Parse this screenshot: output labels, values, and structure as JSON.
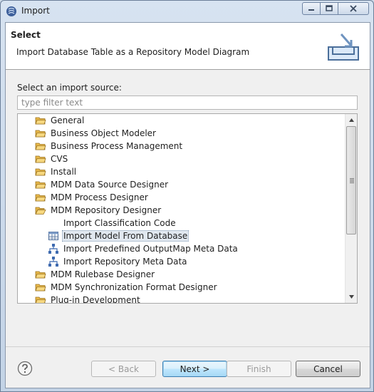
{
  "window": {
    "title": "Import"
  },
  "header": {
    "title": "Select",
    "description": "Import Database Table as a Repository Model Diagram"
  },
  "source": {
    "label": "Select an import source:",
    "filter_placeholder": "type filter text",
    "filter_value": ""
  },
  "tree": {
    "items": [
      {
        "label": "General",
        "type": "folder",
        "level": 0
      },
      {
        "label": "Business Object Modeler",
        "type": "folder",
        "level": 0
      },
      {
        "label": "Business Process Management",
        "type": "folder",
        "level": 0
      },
      {
        "label": "CVS",
        "type": "folder",
        "level": 0
      },
      {
        "label": "Install",
        "type": "folder",
        "level": 0
      },
      {
        "label": "MDM Data Source Designer",
        "type": "folder",
        "level": 0
      },
      {
        "label": "MDM Process Designer",
        "type": "folder",
        "level": 0
      },
      {
        "label": "MDM Repository Designer",
        "type": "folder-open",
        "level": 0
      },
      {
        "label": "Import Classification Code",
        "type": "none",
        "level": 1
      },
      {
        "label": "Import Model From Database",
        "type": "table",
        "level": 1,
        "selected": true
      },
      {
        "label": "Import Predefined OutputMap Meta Data",
        "type": "hierarchy",
        "level": 1
      },
      {
        "label": "Import Repository Meta Data",
        "type": "hierarchy",
        "level": 1
      },
      {
        "label": "MDM Rulebase Designer",
        "type": "folder",
        "level": 0
      },
      {
        "label": "MDM Synchronization Format Designer",
        "type": "folder",
        "level": 0
      },
      {
        "label": "Plug-in Development",
        "type": "folder",
        "level": 0
      }
    ]
  },
  "buttons": {
    "back": "< Back",
    "next": "Next >",
    "finish": "Finish",
    "cancel": "Cancel"
  },
  "colors": {
    "folder": "#e8b84a",
    "accent": "#3c7fb1"
  }
}
